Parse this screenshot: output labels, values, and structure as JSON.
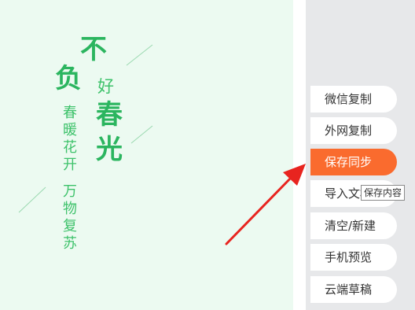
{
  "poster": {
    "line1": "不",
    "line2": "负",
    "word_hao": "好",
    "word_chun": "春",
    "word_guang": "光",
    "col1": [
      "春",
      "暖",
      "花",
      "开"
    ],
    "col2": [
      "万",
      "物",
      "复",
      "苏"
    ],
    "accent_color": "#2bb55f"
  },
  "sidebar": {
    "items": [
      {
        "label": "微信复制"
      },
      {
        "label": "外网复制"
      },
      {
        "label": "保存同步"
      },
      {
        "label": "导入文档"
      },
      {
        "label": "清空/新建"
      },
      {
        "label": "手机预览"
      },
      {
        "label": "云端草稿"
      }
    ],
    "active_color": "#fa6b2e"
  },
  "tooltip": {
    "text": "保存内容"
  },
  "annotation": {
    "arrow_color": "#e8241f"
  }
}
